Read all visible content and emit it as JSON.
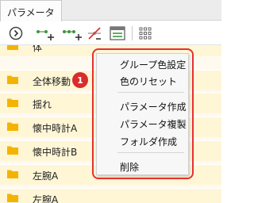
{
  "panel": {
    "tab_label": "パラメータ"
  },
  "toolbar": {
    "buttons": [
      {
        "icon": "collapse-circle-icon"
      },
      {
        "icon": "add-parameter-icon"
      },
      {
        "icon": "add-multiple-parameters-icon"
      },
      {
        "icon": "delete-parameter-icon"
      },
      {
        "icon": "parameter-panel-icon"
      },
      {
        "icon": "grid-view-icon"
      }
    ]
  },
  "tree": {
    "colors": {
      "row_background": "#fff6d6",
      "folder_icon": "#f5b301"
    },
    "rows": [
      {
        "label": "体"
      },
      {
        "label": "全体移動"
      },
      {
        "label": "揺れ"
      },
      {
        "label": "懐中時計A"
      },
      {
        "label": "懐中時計B"
      },
      {
        "label": "左腕A"
      },
      {
        "label": "左腕A"
      }
    ]
  },
  "annotation": {
    "badge_label": "1",
    "color": "#d92c2c"
  },
  "context_menu": {
    "items": [
      {
        "label": "グループ色設定"
      },
      {
        "label": "色のリセット"
      },
      {
        "label": "パラメータ作成"
      },
      {
        "label": "パラメータ複製"
      },
      {
        "label": "フォルダ作成"
      },
      {
        "label": "削除"
      }
    ]
  }
}
